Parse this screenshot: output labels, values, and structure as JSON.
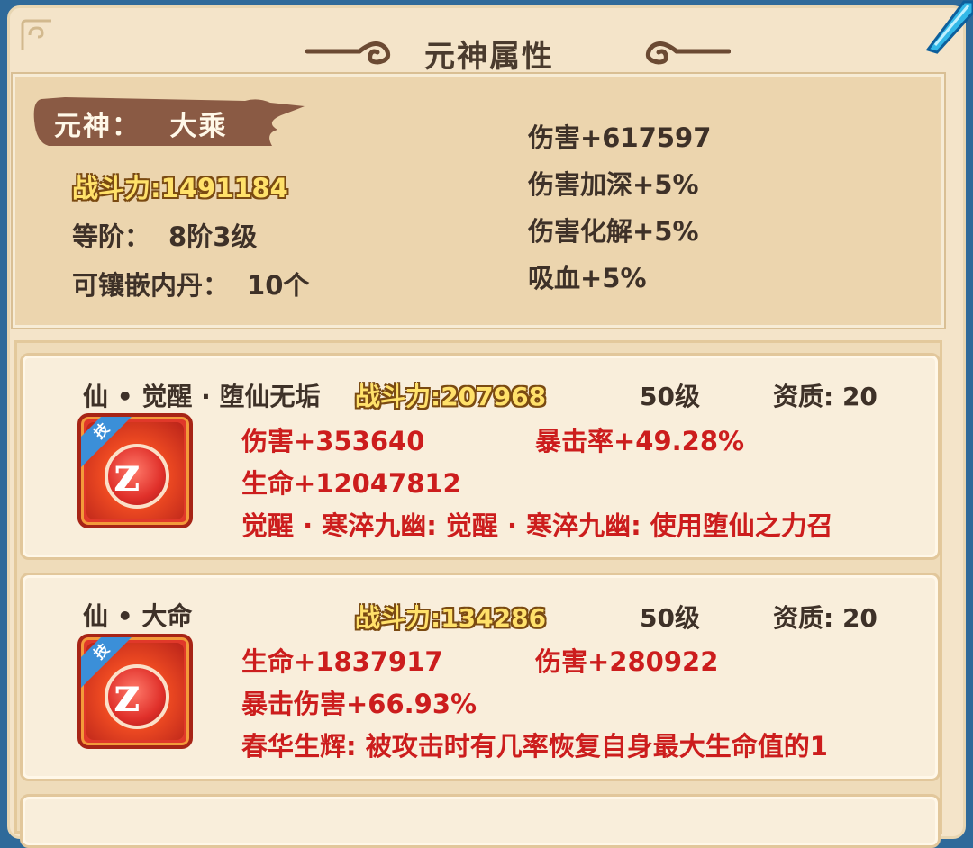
{
  "window": {
    "title": "元神属性"
  },
  "summary": {
    "yuanshen_label": "元神：",
    "yuanshen_value": "大乘",
    "power_label": "战斗力:",
    "power_value": "1491184",
    "rank_label": "等阶：",
    "rank_value": "8阶3级",
    "slots_label": "可镶嵌内丹：",
    "slots_value": "10个",
    "stats": [
      "伤害+617597",
      "伤害加深+5%",
      "伤害化解+5%",
      "吸血+5%"
    ]
  },
  "cards": [
    {
      "name": "仙 • 觉醒 · 堕仙无垢",
      "power_label": "战斗力:",
      "power_value": "207968",
      "level": "50级",
      "quality": "资质: 20",
      "icon_badge": "技",
      "stat1": "伤害+353640",
      "stat2": "暴击率+49.28%",
      "stat3": "生命+12047812",
      "effect": "觉醒 · 寒淬九幽: 觉醒 · 寒淬九幽: 使用堕仙之力召"
    },
    {
      "name": "仙 • 大命",
      "power_label": "战斗力:",
      "power_value": "134286",
      "level": "50级",
      "quality": "资质: 20",
      "icon_badge": "技",
      "stat1": "生命+1837917",
      "stat2": "伤害+280922",
      "stat3": "暴击伤害+66.93%",
      "effect": "春华生辉: 被攻击时有几率恢复自身最大生命值的1"
    }
  ],
  "colors": {
    "frame_bg": "#f4e4c9",
    "panel_bg": "#ecd5ae",
    "gold": "#ffe16a",
    "red_text": "#cc1d1d",
    "dark_text": "#3e3128",
    "ribbon": "#8a5a44"
  }
}
